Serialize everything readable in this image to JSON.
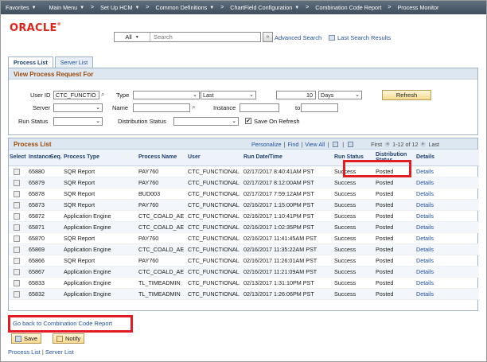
{
  "nav": {
    "items": [
      {
        "label": "Favorites",
        "has_menu": true
      },
      {
        "label": "Main Menu",
        "has_menu": true
      },
      {
        "label": "Set Up HCM",
        "has_menu": true
      },
      {
        "label": "Common Definitions",
        "has_menu": true
      },
      {
        "label": "ChartField Configuration",
        "has_menu": true
      },
      {
        "label": "Combination Code Report",
        "has_menu": false
      },
      {
        "label": "Process Monitor",
        "has_menu": false
      }
    ],
    "separator": ">"
  },
  "header": {
    "logo_text": "ORACLE",
    "search_scope": "All",
    "search_placeholder": "Search",
    "go_label": "»",
    "advanced_search": "Advanced Search",
    "last_results": "Last Search Results"
  },
  "tabs": [
    {
      "label": "Process List",
      "active": true
    },
    {
      "label": "Server List",
      "active": false
    }
  ],
  "request_panel": {
    "title": "View Process Request For",
    "user_id_label": "User ID",
    "user_id_value": "CTC_FUNCTIO",
    "type_label": "Type",
    "type_value": "",
    "period_value": "Last",
    "period_count": "10",
    "period_unit": "Days",
    "refresh_label": "Refresh",
    "server_label": "Server",
    "server_value": "",
    "name_label": "Name",
    "name_value": "",
    "instance_label": "Instance",
    "instance_from": "",
    "to_label": "to",
    "instance_to": "",
    "run_status_label": "Run Status",
    "run_status_value": "",
    "dist_status_label": "Distribution Status",
    "dist_status_value": "",
    "save_on_refresh_label": "Save On Refresh",
    "save_on_refresh_checked": true
  },
  "process_list": {
    "title": "Process List",
    "personalize": "Personalize",
    "find": "Find",
    "view_all": "View All",
    "first": "First",
    "range": "1-12 of 12",
    "last": "Last",
    "columns": [
      "Select",
      "Instance",
      "Seq.",
      "Process Type",
      "Process Name",
      "User",
      "Run Date/Time",
      "Run Status",
      "Distribution Status",
      "Details"
    ],
    "rows": [
      {
        "instance": "65880",
        "seq": "",
        "type": "SQR Report",
        "name": "PAY760",
        "user": "CTC_FUNCTIONAL",
        "datetime": "02/17/2017  8:40:41AM PST",
        "status": "Success",
        "dist": "Posted",
        "details": "Details"
      },
      {
        "instance": "65879",
        "seq": "",
        "type": "SQR Report",
        "name": "PAY760",
        "user": "CTC_FUNCTIONAL",
        "datetime": "02/17/2017  8:12:00AM PST",
        "status": "Success",
        "dist": "Posted",
        "details": "Details"
      },
      {
        "instance": "65878",
        "seq": "",
        "type": "SQR Report",
        "name": "BUD003",
        "user": "CTC_FUNCTIONAL",
        "datetime": "02/17/2017  7:59:12AM PST",
        "status": "Success",
        "dist": "Posted",
        "details": "Details"
      },
      {
        "instance": "65873",
        "seq": "",
        "type": "SQR Report",
        "name": "PAY760",
        "user": "CTC_FUNCTIONAL",
        "datetime": "02/16/2017  1:15:00PM PST",
        "status": "Success",
        "dist": "Posted",
        "details": "Details"
      },
      {
        "instance": "65872",
        "seq": "",
        "type": "Application Engine",
        "name": "CTC_COALD_AE",
        "user": "CTC_FUNCTIONAL",
        "datetime": "02/16/2017  1:10:41PM PST",
        "status": "Success",
        "dist": "Posted",
        "details": "Details"
      },
      {
        "instance": "65871",
        "seq": "",
        "type": "Application Engine",
        "name": "CTC_COALD_AE",
        "user": "CTC_FUNCTIONAL",
        "datetime": "02/16/2017  1:02:35PM PST",
        "status": "Success",
        "dist": "Posted",
        "details": "Details"
      },
      {
        "instance": "65870",
        "seq": "",
        "type": "SQR Report",
        "name": "PAY760",
        "user": "CTC_FUNCTIONAL",
        "datetime": "02/16/2017 11:41:45AM PST",
        "status": "Success",
        "dist": "Posted",
        "details": "Details"
      },
      {
        "instance": "65869",
        "seq": "",
        "type": "Application Engine",
        "name": "CTC_COALD_AE",
        "user": "CTC_FUNCTIONAL",
        "datetime": "02/16/2017 11:35:22AM PST",
        "status": "Success",
        "dist": "Posted",
        "details": "Details"
      },
      {
        "instance": "65866",
        "seq": "",
        "type": "SQR Report",
        "name": "PAY760",
        "user": "CTC_FUNCTIONAL",
        "datetime": "02/16/2017 11:26:01AM PST",
        "status": "Success",
        "dist": "Posted",
        "details": "Details"
      },
      {
        "instance": "65867",
        "seq": "",
        "type": "Application Engine",
        "name": "CTC_COALD_AE",
        "user": "CTC_FUNCTIONAL",
        "datetime": "02/16/2017 11:21:09AM PST",
        "status": "Success",
        "dist": "Posted",
        "details": "Details"
      },
      {
        "instance": "65833",
        "seq": "",
        "type": "Application Engine",
        "name": "TL_TIMEADMIN",
        "user": "CTC_FUNCTIONAL",
        "datetime": "02/13/2017  1:31:10PM PST",
        "status": "Success",
        "dist": "Posted",
        "details": "Details"
      },
      {
        "instance": "65832",
        "seq": "",
        "type": "Application Engine",
        "name": "TL_TIMEADMIN",
        "user": "CTC_FUNCTIONAL",
        "datetime": "02/13/2017  1:26:06PM PST",
        "status": "Success",
        "dist": "Posted",
        "details": "Details"
      }
    ]
  },
  "footer": {
    "go_back": "Go back to Combination Code Report",
    "save_label": "Save",
    "notify_label": "Notify",
    "link_process_list": "Process List",
    "link_server_list": "Server List",
    "separator": "|"
  },
  "colors": {
    "highlight": "#e31c23",
    "oracle_red": "#e2231a",
    "section_title": "#9c4a0a",
    "link": "#1d4f9c"
  }
}
